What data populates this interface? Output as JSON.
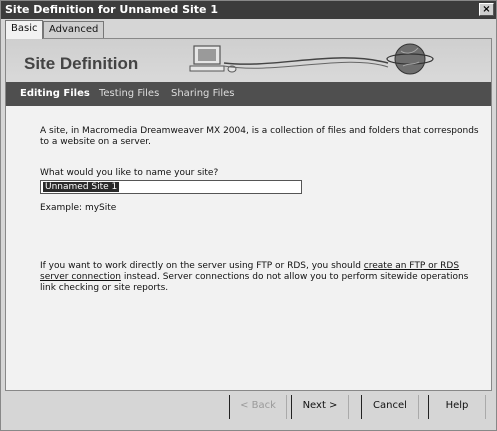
{
  "window": {
    "title": "Site Definition for Unnamed Site 1",
    "close_glyph": "×"
  },
  "tabs": [
    {
      "label": "Basic"
    },
    {
      "label": "Advanced"
    }
  ],
  "banner": {
    "title": "Site Definition",
    "art": [
      "computer-icon",
      "globe-icon"
    ]
  },
  "nav": [
    {
      "label": "Editing Files"
    },
    {
      "label": "Testing Files"
    },
    {
      "label": "Sharing Files"
    }
  ],
  "body": {
    "intro_1": "A site, in Macromedia Dreamweaver MX 2004, is a collection of files and folders that corresponds",
    "intro_2": "to a website on a server.",
    "question": "What would you like to name your site?",
    "site_name_value": "Unnamed Site 1",
    "example": "Example: mySite",
    "ftp_1_before": "If you want to work directly on the server using FTP or RDS, you should ",
    "ftp_1_link": "create an FTP or RDS",
    "ftp_2_link": "server connection",
    "ftp_2_after": " instead. Server connections do not allow you to perform sitewide operations",
    "ftp_3": "link checking or site reports."
  },
  "buttons": {
    "back": "< Back",
    "next": "Next >",
    "cancel": "Cancel",
    "help": "Help"
  }
}
